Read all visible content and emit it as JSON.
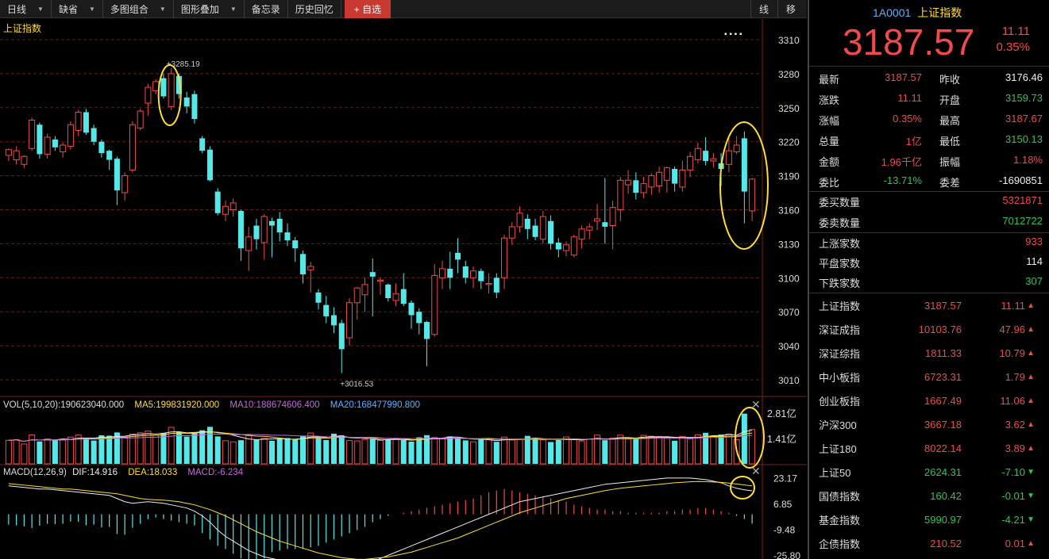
{
  "toolbar": {
    "items": [
      "日线",
      "缺省",
      "多图组合",
      "图形叠加",
      "备忘录",
      "历史回忆"
    ],
    "add_label": "+ 自选",
    "right": [
      "线",
      "移"
    ]
  },
  "main_panel": {
    "title": "上证指数",
    "y_ticks": [
      "3310",
      "3280",
      "3250",
      "3220",
      "3190",
      "3160",
      "3130",
      "3100",
      "3070",
      "3040",
      "3010"
    ],
    "high_label": "3285.19",
    "low_label": "3016.53",
    "dots": "▪ ▪ ▪ ▪"
  },
  "vol_panel": {
    "label": "VOL(5,10,20)",
    "value": ":190623040.000",
    "ma5": "MA5:199831920.000",
    "ma10": "MA10:188674606.400",
    "ma20": "MA20:168477990.800",
    "y_ticks": [
      "2.81亿",
      "1.41亿"
    ]
  },
  "macd_panel": {
    "label": "MACD(12,26,9)",
    "dif": "DIF:14.916",
    "dea": "DEA:18.033",
    "macd": "MACD:-6.234",
    "y_ticks": [
      "23.17",
      "6.85",
      "-9.48",
      "-25.80"
    ]
  },
  "colors": {
    "up": "#f24a4a",
    "down": "#54e8e8",
    "accent": "#ffdd33",
    "ma10": "#c06cd8",
    "ma20": "#5fb0ff"
  },
  "chart_data": {
    "type": "candlestick",
    "y_range": [
      3000,
      3320
    ],
    "candles": [
      [
        3208,
        3213,
        3203,
        3214
      ],
      [
        3204,
        3212,
        3200,
        3216
      ],
      [
        3200,
        3207,
        3197,
        3208
      ],
      [
        3214,
        3239,
        3212,
        3241
      ],
      [
        3235,
        3209,
        3205,
        3237
      ],
      [
        3209,
        3224,
        3205,
        3227
      ],
      [
        3222,
        3215,
        3212,
        3225
      ],
      [
        3211,
        3217,
        3206,
        3219
      ],
      [
        3216,
        3235,
        3213,
        3238
      ],
      [
        3230,
        3246,
        3225,
        3248
      ],
      [
        3246,
        3228,
        3226,
        3249
      ],
      [
        3232,
        3220,
        3217,
        3235
      ],
      [
        3220,
        3210,
        3206,
        3222
      ],
      [
        3212,
        3204,
        3195,
        3213
      ],
      [
        3205,
        3177,
        3164,
        3207
      ],
      [
        3175,
        3190,
        3168,
        3193
      ],
      [
        3195,
        3235,
        3193,
        3238
      ],
      [
        3232,
        3247,
        3230,
        3249
      ],
      [
        3254,
        3268,
        3243,
        3271
      ],
      [
        3265,
        3273,
        3262,
        3275
      ],
      [
        3276,
        3260,
        3258,
        3280
      ],
      [
        3251,
        3280,
        3248,
        3285
      ],
      [
        3278,
        3262,
        3258,
        3280
      ],
      [
        3259,
        3251,
        3245,
        3264
      ],
      [
        3262,
        3240,
        3236,
        3265
      ],
      [
        3223,
        3212,
        3210,
        3225
      ],
      [
        3213,
        3186,
        3185,
        3216
      ],
      [
        3176,
        3157,
        3155,
        3179
      ],
      [
        3156,
        3163,
        3150,
        3168
      ],
      [
        3160,
        3166,
        3154,
        3170
      ],
      [
        3159,
        3126,
        3115,
        3160
      ],
      [
        3124,
        3136,
        3106,
        3145
      ],
      [
        3146,
        3134,
        3125,
        3152
      ],
      [
        3131,
        3154,
        3116,
        3156
      ],
      [
        3150,
        3146,
        3118,
        3153
      ],
      [
        3152,
        3140,
        3132,
        3158
      ],
      [
        3140,
        3133,
        3128,
        3148
      ],
      [
        3133,
        3126,
        3114,
        3136
      ],
      [
        3121,
        3103,
        3095,
        3124
      ],
      [
        3107,
        3110,
        3087,
        3114
      ],
      [
        3087,
        3078,
        3072,
        3090
      ],
      [
        3076,
        3066,
        3060,
        3084
      ],
      [
        3067,
        3058,
        3051,
        3074
      ],
      [
        3060,
        3037,
        3016,
        3063
      ],
      [
        3047,
        3078,
        3040,
        3082
      ],
      [
        3078,
        3091,
        3063,
        3092
      ],
      [
        3085,
        3094,
        3070,
        3100
      ],
      [
        3105,
        3101,
        3066,
        3117
      ],
      [
        3097,
        3098,
        3085,
        3100
      ],
      [
        3094,
        3082,
        3079,
        3095
      ],
      [
        3080,
        3086,
        3075,
        3095
      ],
      [
        3090,
        3077,
        3075,
        3104
      ],
      [
        3078,
        3067,
        3055,
        3080
      ],
      [
        3070,
        3060,
        3050,
        3073
      ],
      [
        3061,
        3046,
        3022,
        3062
      ],
      [
        3050,
        3102,
        3048,
        3112
      ],
      [
        3100,
        3108,
        3090,
        3115
      ],
      [
        3108,
        3100,
        3090,
        3123
      ],
      [
        3122,
        3116,
        3104,
        3135
      ],
      [
        3110,
        3100,
        3095,
        3115
      ],
      [
        3100,
        3106,
        3091,
        3110
      ],
      [
        3106,
        3097,
        3090,
        3108
      ],
      [
        3094,
        3095,
        3086,
        3104
      ],
      [
        3100,
        3087,
        3082,
        3104
      ],
      [
        3100,
        3135,
        3090,
        3138
      ],
      [
        3135,
        3145,
        3129,
        3149
      ],
      [
        3145,
        3157,
        3140,
        3163
      ],
      [
        3152,
        3143,
        3134,
        3156
      ],
      [
        3146,
        3136,
        3133,
        3152
      ],
      [
        3134,
        3154,
        3130,
        3159
      ],
      [
        3150,
        3130,
        3125,
        3155
      ],
      [
        3131,
        3125,
        3118,
        3135
      ],
      [
        3124,
        3129,
        3119,
        3132
      ],
      [
        3120,
        3136,
        3118,
        3138
      ],
      [
        3134,
        3143,
        3126,
        3146
      ],
      [
        3142,
        3145,
        3134,
        3148
      ],
      [
        3150,
        3152,
        3142,
        3165
      ],
      [
        3149,
        3145,
        3130,
        3188
      ],
      [
        3146,
        3162,
        3125,
        3168
      ],
      [
        3160,
        3186,
        3150,
        3189
      ],
      [
        3182,
        3186,
        3174,
        3195
      ],
      [
        3186,
        3175,
        3169,
        3193
      ],
      [
        3175,
        3183,
        3170,
        3189
      ],
      [
        3180,
        3190,
        3173,
        3192
      ],
      [
        3181,
        3193,
        3175,
        3198
      ],
      [
        3186,
        3197,
        3175,
        3198
      ],
      [
        3196,
        3183,
        3176,
        3198
      ],
      [
        3180,
        3195,
        3176,
        3203
      ],
      [
        3195,
        3207,
        3189,
        3211
      ],
      [
        3204,
        3214,
        3201,
        3219
      ],
      [
        3212,
        3203,
        3199,
        3224
      ],
      [
        3203,
        3205,
        3197,
        3210
      ],
      [
        3201,
        3196,
        3181,
        3210
      ],
      [
        3200,
        3212,
        3193,
        3224
      ],
      [
        3211,
        3217,
        3209,
        3225
      ],
      [
        3223,
        3176,
        3148,
        3229
      ],
      [
        3159,
        3187,
        3150,
        3188
      ]
    ],
    "volumes": [
      1.3,
      1.34,
      1.1,
      1.6,
      1.24,
      1.38,
      1.3,
      1.36,
      1.48,
      1.6,
      1.4,
      1.29,
      1.58,
      1.56,
      1.74,
      1.48,
      1.65,
      1.72,
      1.81,
      1.58,
      1.71,
      2.02,
      1.76,
      1.51,
      1.71,
      1.86,
      2.05,
      1.52,
      1.28,
      1.22,
      1.31,
      1.57,
      1.32,
      1.41,
      1.28,
      1.39,
      1.43,
      1.35,
      1.55,
      1.71,
      1.42,
      1.32,
      1.67,
      1.58,
      1.29,
      1.27,
      1.36,
      1.41,
      1.3,
      1.35,
      1.36,
      1.32,
      1.23,
      1.47,
      1.59,
      1.46,
      1.39,
      1.52,
      1.44,
      1.3,
      1.22,
      1.35,
      1.36,
      1.22,
      1.48,
      1.32,
      1.37,
      1.55,
      1.41,
      1.33,
      1.21,
      1.32,
      1.49,
      1.35,
      1.27,
      1.37,
      1.59,
      1.31,
      1.42,
      1.59,
      1.37,
      1.44,
      1.58,
      1.53,
      1.52,
      1.44,
      1.28,
      1.52,
      1.38,
      1.61,
      1.72,
      1.55,
      1.62,
      1.65,
      1.34,
      2.78,
      1.9
    ],
    "macd_hist": [
      -6.5,
      -7,
      -7.6,
      -8.7,
      -7.2,
      -6,
      -6.2,
      -6,
      -4.6,
      -4.7,
      -7,
      -6.5,
      -8.3,
      -8,
      -12.5,
      -13,
      -8.5,
      -6,
      -3,
      -2,
      -3,
      -4,
      -5,
      -6,
      -7,
      -12,
      -16,
      -20,
      -22,
      -25,
      -28,
      -30,
      -31,
      -28,
      -24,
      -23,
      -22,
      -22,
      -22,
      -21,
      -20,
      -18,
      -16,
      -14,
      -12,
      -10,
      -8,
      -5,
      -3,
      -1,
      0,
      1,
      2,
      3,
      4,
      5,
      6,
      7,
      8,
      9,
      10,
      12,
      14,
      15,
      16,
      15,
      14,
      13,
      12,
      11,
      10,
      9,
      8,
      6,
      5,
      4,
      3,
      3,
      2,
      2,
      1,
      1,
      1,
      1,
      1,
      2,
      2,
      3,
      3,
      4,
      4,
      3,
      2,
      1,
      -1,
      -3,
      -6
    ],
    "dif": [
      18,
      17.5,
      17,
      16.5,
      16,
      16,
      15.5,
      15,
      14.5,
      14,
      13.5,
      13,
      12.5,
      12,
      10,
      8,
      7,
      7.5,
      8,
      7.5,
      7,
      6,
      5,
      4,
      2,
      -1,
      -5,
      -10,
      -14,
      -17,
      -20,
      -23,
      -25,
      -27,
      -28,
      -29,
      -30,
      -31,
      -32,
      -33,
      -34,
      -35,
      -35,
      -35,
      -34,
      -33,
      -32,
      -30,
      -28,
      -26,
      -24,
      -22,
      -20,
      -18,
      -16,
      -14,
      -12,
      -10,
      -8,
      -6,
      -4,
      -2,
      0,
      2,
      4,
      6,
      8,
      9,
      10,
      11,
      12,
      13,
      14,
      15,
      16,
      17,
      18,
      19,
      19.5,
      20,
      20.5,
      21,
      21.5,
      22,
      22.5,
      23,
      23,
      23,
      23,
      22.5,
      22,
      21,
      20,
      18,
      16.5,
      15.5,
      14.9
    ],
    "dea": [
      19.5,
      19,
      18.5,
      18,
      17.5,
      17,
      16.5,
      16,
      16,
      15.5,
      15,
      14.5,
      14,
      13.5,
      13,
      12,
      11,
      10,
      9.5,
      9.2,
      9,
      8.5,
      8,
      7,
      6,
      4.5,
      3,
      1,
      -1,
      -3.5,
      -6,
      -8.5,
      -11,
      -13,
      -15,
      -17,
      -18.5,
      -20,
      -21.5,
      -23,
      -24.5,
      -25.5,
      -26.5,
      -27.5,
      -28,
      -28.5,
      -28.5,
      -28,
      -27.5,
      -27,
      -26,
      -25,
      -24,
      -22.5,
      -21,
      -19.5,
      -18,
      -16.5,
      -15,
      -13,
      -11,
      -9,
      -7,
      -5,
      -3,
      -1,
      1,
      2.5,
      4,
      5.5,
      7,
      8.5,
      10,
      11,
      12,
      13,
      14,
      15,
      15.8,
      16.5,
      17,
      17.5,
      18,
      18.5,
      19,
      19.5,
      20,
      20.3,
      20.6,
      20.8,
      20.7,
      20.5,
      20.2,
      19.8,
      19.2,
      18.6,
      18
    ]
  },
  "quote": {
    "code": "1A0001",
    "name": "上证指数",
    "price": "3187.57",
    "change": "11.11",
    "pct": "0.35%",
    "rows": [
      {
        "l1": "最新",
        "v1": "3187.57",
        "c1": "red",
        "l2": "昨收",
        "v2": "3176.46",
        "c2": "white"
      },
      {
        "l1": "涨跌",
        "v1": "11.11",
        "c1": "red",
        "l2": "开盘",
        "v2": "3159.73",
        "c2": "green"
      },
      {
        "l1": "涨幅",
        "v1": "0.35%",
        "c1": "red",
        "l2": "最高",
        "v2": "3187.67",
        "c2": "red"
      },
      {
        "l1": "总量",
        "v1": "1亿",
        "c1": "red",
        "l2": "最低",
        "v2": "3150.13",
        "c2": "green"
      },
      {
        "l1": "金额",
        "v1": "1.96千亿",
        "c1": "red",
        "l2": "振幅",
        "v2": "1.18%",
        "c2": "red"
      },
      {
        "l1": "委比",
        "v1": "-13.71%",
        "c1": "green",
        "l2": "委差",
        "v2": "-1690851",
        "c2": "white"
      }
    ],
    "buy_qty_label": "委买数量",
    "buy_qty": "5321871",
    "sell_qty_label": "委卖数量",
    "sell_qty": "7012722",
    "up_label": "上涨家数",
    "up": "933",
    "flat_label": "平盘家数",
    "flat": "114",
    "down_label": "下跌家数",
    "down": "307"
  },
  "indices": [
    {
      "name": "上证指数",
      "price": "3187.57",
      "chg": "11.11",
      "dir": "up"
    },
    {
      "name": "深证成指",
      "price": "10103.76",
      "chg": "47.96",
      "dir": "up"
    },
    {
      "name": "深证综指",
      "price": "1811.33",
      "chg": "10.79",
      "dir": "up"
    },
    {
      "name": "中小板指",
      "price": "6723.31",
      "chg": "1.79",
      "dir": "up"
    },
    {
      "name": "创业板指",
      "price": "1667.49",
      "chg": "11.06",
      "dir": "up"
    },
    {
      "name": "沪深300",
      "price": "3667.18",
      "chg": "3.62",
      "dir": "up"
    },
    {
      "name": "上证180",
      "price": "8022.14",
      "chg": "3.89",
      "dir": "up"
    },
    {
      "name": "上证50",
      "price": "2624.31",
      "chg": "-7.10",
      "dir": "down"
    },
    {
      "name": "国债指数",
      "price": "160.42",
      "chg": "-0.01",
      "dir": "down"
    },
    {
      "name": "基金指数",
      "price": "5990.97",
      "chg": "-4.21",
      "dir": "down"
    },
    {
      "name": "企债指数",
      "price": "210.52",
      "chg": "0.01",
      "dir": "up"
    }
  ]
}
